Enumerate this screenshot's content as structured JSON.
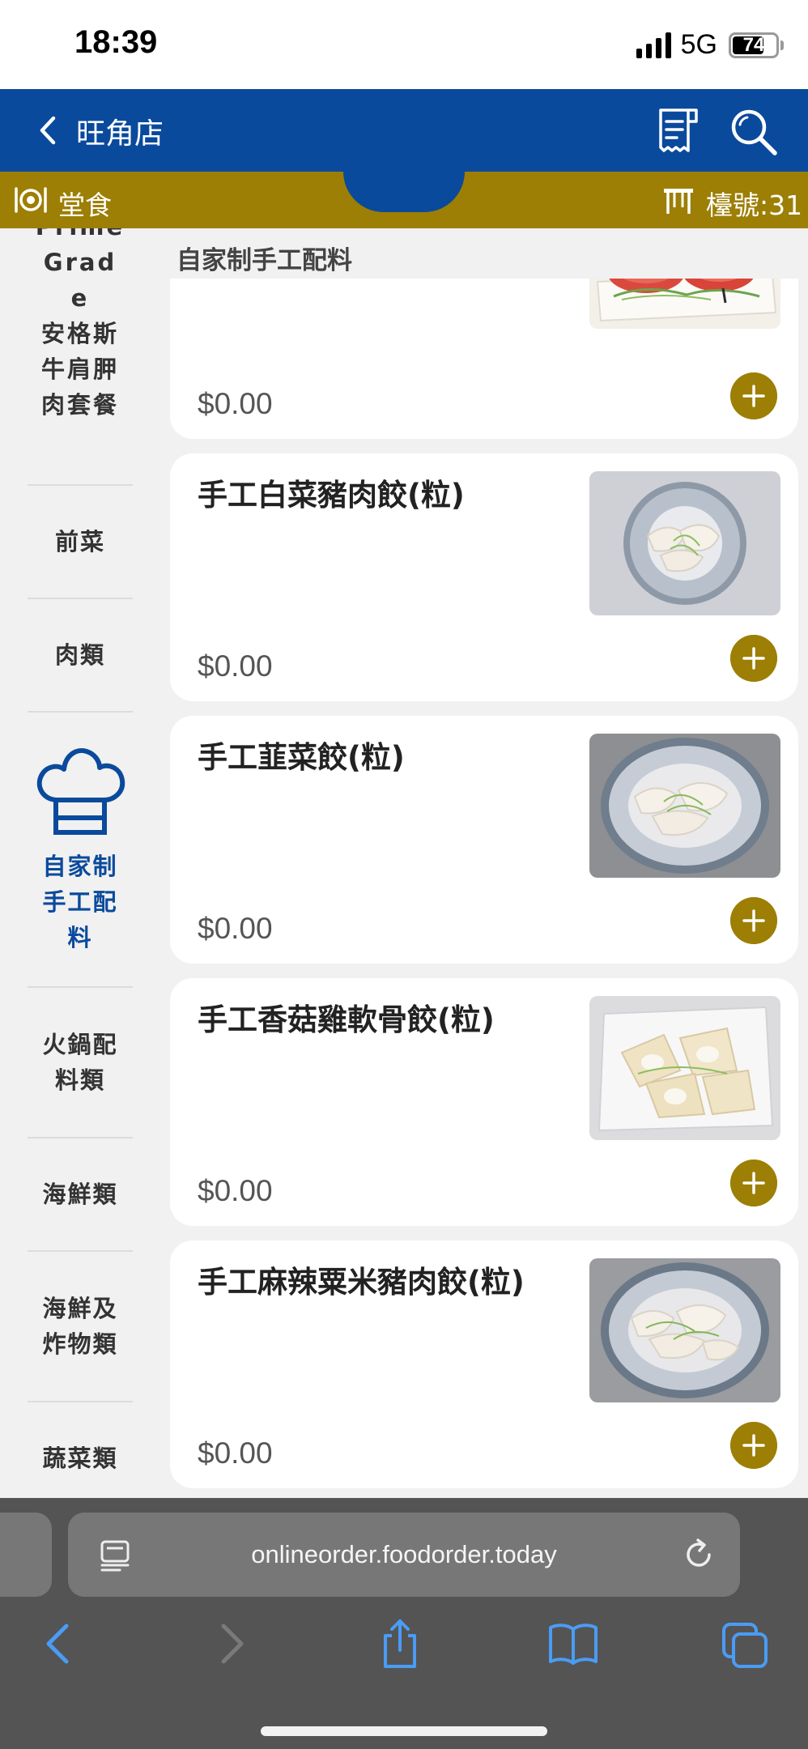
{
  "status_bar": {
    "time": "18:39",
    "network": "5G",
    "battery": "74",
    "battery_level": 0.74
  },
  "header": {
    "store_name": "旺角店"
  },
  "sub_header": {
    "dine_label": "堂食",
    "table_label": "檯號:31"
  },
  "sidebar": {
    "items": [
      {
        "label": "Prime Grade 安格斯牛肩胛肉套餐",
        "lines": [
          "Prime",
          "Grade",
          "安格斯",
          "牛肩胛",
          "肉套餐"
        ],
        "active": false
      },
      {
        "label": "前菜",
        "active": false
      },
      {
        "label": "肉類",
        "active": false
      },
      {
        "label": "自家制手工配料",
        "lines": [
          "自家制",
          "手工配",
          "料"
        ],
        "active": true,
        "icon": "chef-hat-icon"
      },
      {
        "label": "火鍋配料類",
        "lines": [
          "火鍋配",
          "料類"
        ],
        "active": false
      },
      {
        "label": "海鮮類",
        "active": false
      },
      {
        "label": "海鮮及炸物類",
        "lines": [
          "海鮮及",
          "炸物類"
        ],
        "active": false
      },
      {
        "label": "蔬菜類",
        "active": false
      }
    ]
  },
  "main": {
    "section_title": "自家制手工配料",
    "items": [
      {
        "name": "",
        "price": "$0.00",
        "image": "raw-meat-plate"
      },
      {
        "name": "手工白菜豬肉餃(粒)",
        "price": "$0.00",
        "image": "dumplings-striped-plate"
      },
      {
        "name": "手工韮菜餃(粒)",
        "price": "$0.00",
        "image": "dumplings-striped-plate"
      },
      {
        "name": "手工香菇雞軟骨餃(粒)",
        "price": "$0.00",
        "image": "wontons-white-plate"
      },
      {
        "name": "手工麻辣粟米豬肉餃(粒)",
        "price": "$0.00",
        "image": "dumplings-striped-plate"
      }
    ]
  },
  "browser": {
    "url": "onlineorder.foodorder.today"
  },
  "colors": {
    "brand_blue": "#0a4a9c",
    "brand_gold": "#9c7f04",
    "sidebar_bg": "#f1f1f1"
  }
}
